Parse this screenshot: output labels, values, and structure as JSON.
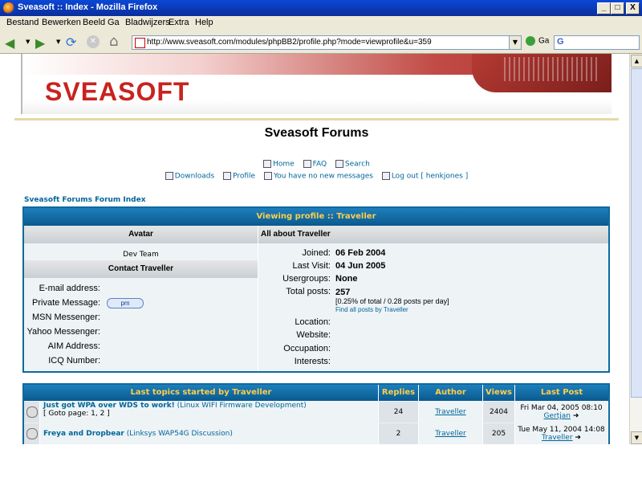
{
  "window": {
    "title": "Sveasoft :: Index - Mozilla Firefox",
    "btn_min": "_",
    "btn_max": "□",
    "btn_close": "X"
  },
  "menu": {
    "items": [
      "Bestand",
      "Bewerken",
      "Beeld",
      "Ga",
      "Bladwijzers",
      "Extra",
      "Help"
    ]
  },
  "toolbar": {
    "url": "http://www.sveasoft.com/modules/phpBB2/profile.php?mode=viewprofile&u=359",
    "go_label": "Ga",
    "search_glyph": "G"
  },
  "banner": {
    "logo": "SVEASOFT"
  },
  "forum": {
    "title": "Sveasoft Forums",
    "links_row1": [
      "Home",
      "FAQ",
      "Search"
    ],
    "links_row2": [
      "Downloads",
      "Profile",
      "You have no new messages",
      "Log out [ henkjones ]"
    ],
    "breadcrumb": "Sveasoft Forums Forum Index"
  },
  "profile": {
    "heading": "Viewing profile :: Traveller",
    "col_avatar": "Avatar",
    "col_about": "All about Traveller",
    "rank": "Dev Team",
    "contact_heading": "Contact Traveller",
    "contact_labels": [
      "E-mail address:",
      "Private Message:",
      "MSN Messenger:",
      "Yahoo Messenger:",
      "AIM Address:",
      "ICQ Number:"
    ],
    "pm_button": "pm",
    "about": {
      "joined_label": "Joined:",
      "joined": "06 Feb 2004",
      "lastvisit_label": "Last Visit:",
      "lastvisit": "04 Jun 2005",
      "usergroups_label": "Usergroups:",
      "usergroups": "None",
      "posts_label": "Total posts:",
      "posts": "257",
      "posts_detail": "[0.25% of total / 0.28 posts per day]",
      "find_posts": "Find all posts by Traveller",
      "location_label": "Location:",
      "website_label": "Website:",
      "occupation_label": "Occupation:",
      "interests_label": "Interests:"
    }
  },
  "topics": {
    "headers": {
      "title": "Last topics started by Traveller",
      "replies": "Replies",
      "author": "Author",
      "views": "Views",
      "last": "Last Post"
    },
    "rows": [
      {
        "title": "Just got WPA over WDS to work!",
        "forum": "(Linux WIFI Firmware Development)",
        "goto": "[ Goto page: 1, 2 ]",
        "replies": "24",
        "author": "Traveller",
        "views": "2404",
        "last_date": "Fri Mar 04, 2005 08:10",
        "last_user": "Gertjan"
      },
      {
        "title": "Freya and Dropbear",
        "forum": "(Linksys WAP54G Discussion)",
        "goto": "",
        "replies": "2",
        "author": "Traveller",
        "views": "205",
        "last_date": "Tue May 11, 2004 14:08",
        "last_user": "Traveller"
      }
    ]
  }
}
